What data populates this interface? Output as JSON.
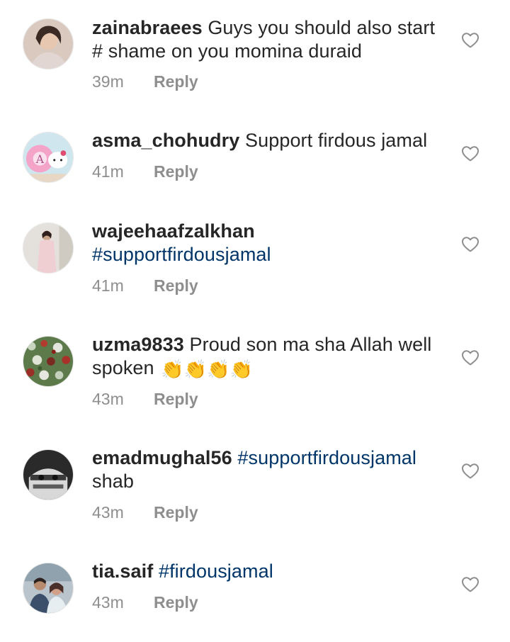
{
  "comments": [
    {
      "username": "zainabraees",
      "text": "Guys you should also start # shame on you momina duraid",
      "hashtag": "",
      "time": "39m",
      "reply_label": "Reply"
    },
    {
      "username": "asma_chohudry",
      "text": "Support firdous jamal",
      "hashtag": "",
      "time": "41m",
      "reply_label": "Reply"
    },
    {
      "username": "wajeehaafzalkhan",
      "text": "",
      "hashtag": "#supportfirdousjamal",
      "time": "41m",
      "reply_label": "Reply"
    },
    {
      "username": "uzma9833",
      "text": "Proud son ma sha Allah well spoken",
      "hashtag": "",
      "emoji": "👏👏👏👏",
      "time": "43m",
      "reply_label": "Reply"
    },
    {
      "username": "emadmughal56",
      "text": "shab",
      "hashtag": "#supportfirdousjamal",
      "time": "43m",
      "reply_label": "Reply"
    },
    {
      "username": "tia.saif",
      "text": "",
      "hashtag": "#firdousjamal",
      "time": "43m",
      "reply_label": "Reply"
    }
  ],
  "icons": {
    "like": "heart-outline-icon"
  },
  "colors": {
    "text": "#262626",
    "hashtag": "#003569",
    "meta": "#8e8e8e",
    "heart": "#8e8e8e"
  }
}
